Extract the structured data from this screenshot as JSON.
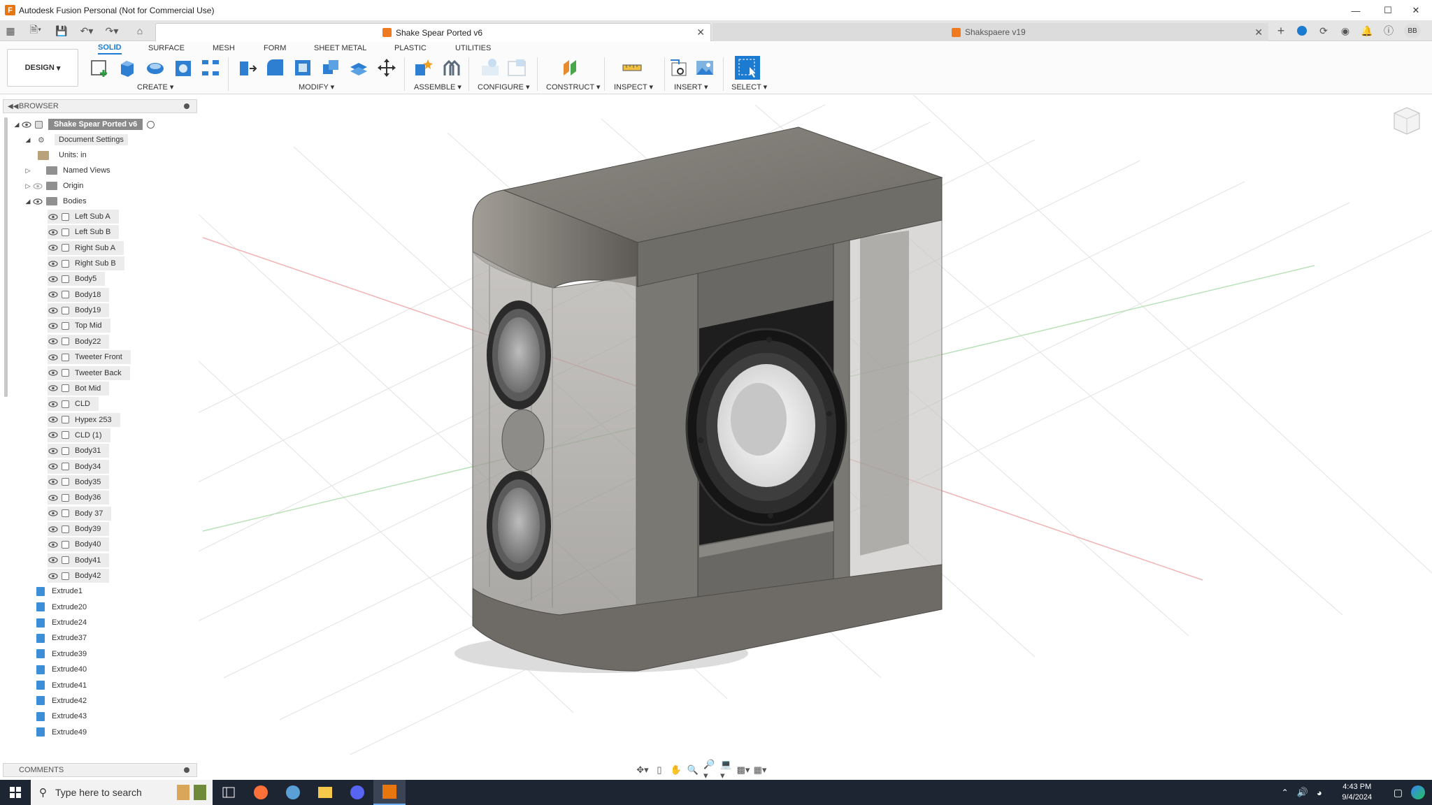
{
  "window": {
    "title": "Autodesk Fusion Personal (Not for Commercial Use)",
    "controls": [
      "minimize-icon",
      "maximize-icon",
      "close-icon"
    ]
  },
  "quick_access": [
    "grid-icon",
    "file-icon",
    "save-icon",
    "undo-icon",
    "redo-icon",
    "home-icon"
  ],
  "tabs": [
    {
      "label": "Shake Spear Ported v6",
      "active": true
    },
    {
      "label": "Shakspaere v19",
      "active": false
    }
  ],
  "tabbar_right": {
    "avatar": "BB"
  },
  "toolbar": {
    "workspace": "DESIGN",
    "workspace_tabs": [
      "SOLID",
      "SURFACE",
      "MESH",
      "FORM",
      "SHEET METAL",
      "PLASTIC",
      "UTILITIES"
    ],
    "groups": [
      "CREATE",
      "MODIFY",
      "ASSEMBLE",
      "CONFIGURE",
      "CONSTRUCT",
      "INSPECT",
      "INSERT",
      "SELECT"
    ]
  },
  "browser": {
    "title": "BROWSER",
    "root": "Shake Spear Ported v6",
    "document_settings": "Document Settings",
    "units": "Units: in",
    "named_views": "Named Views",
    "origin": "Origin",
    "bodies_folder": "Bodies",
    "bodies": [
      "Left Sub A",
      "Left Sub B",
      "Right Sub A",
      "Right Sub B",
      "Body5",
      "Body18",
      "Body19",
      "Top Mid",
      "Body22",
      "Tweeter Front",
      "Tweeter Back",
      "Bot Mid",
      "CLD",
      "Hypex 253",
      "CLD (1)",
      "Body31",
      "Body34",
      "Body35",
      "Body36",
      "Body 37",
      "Body39",
      "Body40",
      "Body41",
      "Body42"
    ],
    "features": [
      "Extrude1",
      "Extrude20",
      "Extrude24",
      "Extrude37",
      "Extrude39",
      "Extrude40",
      "Extrude41",
      "Extrude42",
      "Extrude43",
      "Extrude49"
    ]
  },
  "comments": {
    "title": "COMMENTS"
  },
  "taskbar": {
    "search_placeholder": "Type here to search",
    "time": "4:43 PM",
    "date": "9/4/2024"
  }
}
